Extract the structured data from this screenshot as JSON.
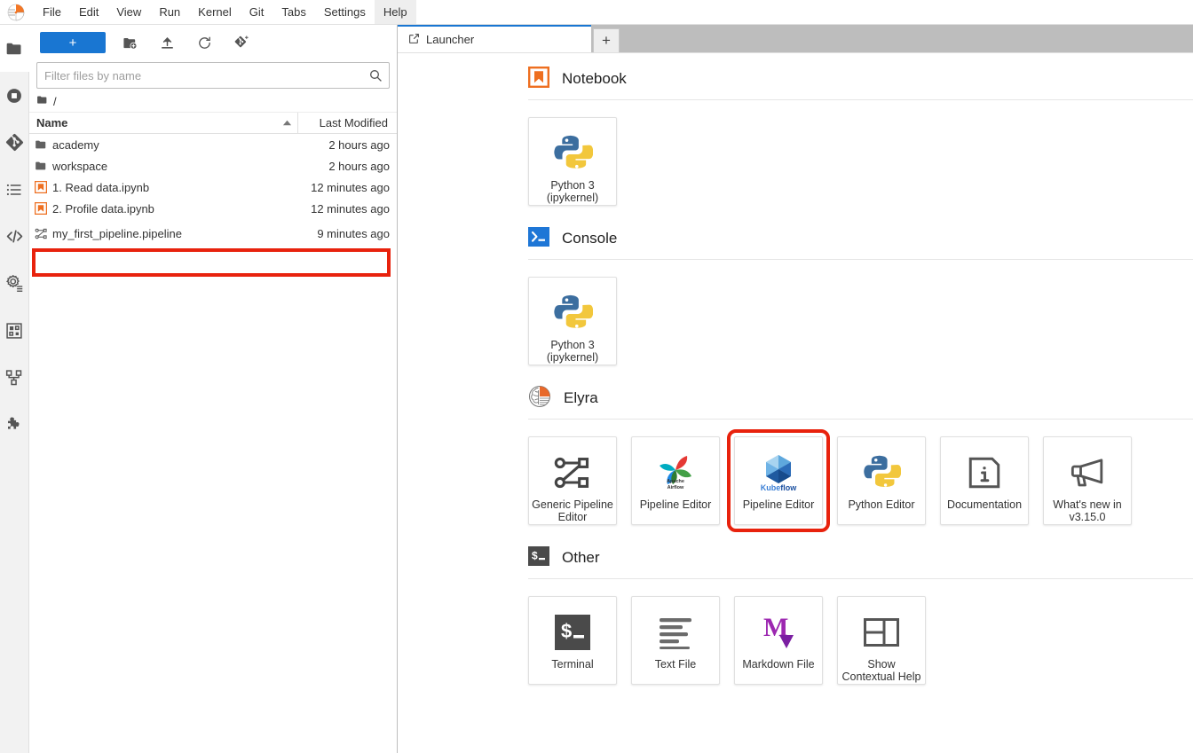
{
  "menubar": {
    "logo_name": "jupyter-logo",
    "items": [
      {
        "label": "File"
      },
      {
        "label": "Edit"
      },
      {
        "label": "View"
      },
      {
        "label": "Run"
      },
      {
        "label": "Kernel"
      },
      {
        "label": "Git"
      },
      {
        "label": "Tabs"
      },
      {
        "label": "Settings"
      },
      {
        "label": "Help",
        "active": true
      }
    ]
  },
  "activitybar": {
    "items": [
      {
        "icon": "folder-icon",
        "name": "sidebar-item-file-browser"
      },
      {
        "icon": "running-terminals-icon",
        "name": "sidebar-item-running"
      },
      {
        "icon": "git-icon",
        "name": "sidebar-item-git"
      },
      {
        "icon": "table-of-contents-icon",
        "name": "sidebar-item-table-of-contents"
      },
      {
        "icon": "code-icon",
        "name": "sidebar-item-debugger"
      },
      {
        "icon": "settings-gear-icon",
        "name": "sidebar-item-pipeline-runtimes"
      },
      {
        "icon": "component-catalog-icon",
        "name": "sidebar-item-component-catalog"
      },
      {
        "icon": "pipeline-nodes-icon",
        "name": "sidebar-item-pipeline-palette"
      },
      {
        "icon": "puzzle-piece-icon",
        "name": "sidebar-item-extension-manager"
      }
    ]
  },
  "filebrowser": {
    "toolbar": {
      "new_label": "+",
      "new_folder_icon": "new-folder-icon",
      "upload_icon": "upload-icon",
      "refresh_icon": "refresh-icon",
      "git_clone_icon": "git-clone-icon"
    },
    "filter": {
      "placeholder": "Filter files by name",
      "value": "",
      "search_icon": "search-icon"
    },
    "breadcrumb": {
      "root_icon": "folder-icon",
      "path": "/"
    },
    "columns": {
      "name": "Name",
      "last_modified": "Last Modified",
      "sort_icon": "sort-ascending-icon"
    },
    "rows": [
      {
        "name": "academy",
        "modified": "2 hours ago",
        "icon": "folder-icon",
        "highlighted": false
      },
      {
        "name": "workspace",
        "modified": "2 hours ago",
        "icon": "folder-icon",
        "highlighted": false
      },
      {
        "name": "1. Read data.ipynb",
        "modified": "12 minutes ago",
        "icon": "notebook-icon",
        "highlighted": false
      },
      {
        "name": "2. Profile data.ipynb",
        "modified": "12 minutes ago",
        "icon": "notebook-icon",
        "highlighted": false
      },
      {
        "name": "my_first_pipeline.pipeline",
        "modified": "9 minutes ago",
        "icon": "pipeline-icon",
        "highlighted": true
      }
    ]
  },
  "main": {
    "tabs": [
      {
        "label": "Launcher",
        "icon": "launcher-icon",
        "active": true
      }
    ],
    "add_tab_label": "+",
    "launcher": {
      "sections": [
        {
          "title": "Notebook",
          "icon": "notebook-icon",
          "cards": [
            {
              "label": "Python 3\n(ipykernel)",
              "icon": "python-icon",
              "highlighted": false
            }
          ]
        },
        {
          "title": "Console",
          "icon": "console-icon",
          "cards": [
            {
              "label": "Python 3\n(ipykernel)",
              "icon": "python-icon",
              "highlighted": false
            }
          ]
        },
        {
          "title": "Elyra",
          "icon": "elyra-icon",
          "cards": [
            {
              "label": "Generic Pipeline Editor",
              "icon": "generic-pipeline-icon",
              "highlighted": false
            },
            {
              "label": "Pipeline Editor",
              "icon": "apache-airflow-icon",
              "highlighted": false
            },
            {
              "label": "Pipeline Editor",
              "icon": "kubeflow-icon",
              "highlighted": true
            },
            {
              "label": "Python Editor",
              "icon": "python-icon",
              "highlighted": false
            },
            {
              "label": "Documentation",
              "icon": "info-icon",
              "highlighted": false
            },
            {
              "label": "What's new in v3.15.0",
              "icon": "megaphone-icon",
              "highlighted": false
            }
          ]
        },
        {
          "title": "Other",
          "icon": "terminal-icon",
          "cards": [
            {
              "label": "Terminal",
              "icon": "terminal-icon",
              "highlighted": false
            },
            {
              "label": "Text File",
              "icon": "text-file-icon",
              "highlighted": false
            },
            {
              "label": "Markdown File",
              "icon": "markdown-icon",
              "highlighted": false
            },
            {
              "label": "Show Contextual Help",
              "icon": "contextual-help-icon",
              "highlighted": false
            }
          ]
        }
      ]
    }
  },
  "colors": {
    "accent_blue": "#1976d2",
    "highlight_red": "#e8220d",
    "notebook_orange": "#ee6f20",
    "elyra_orange": "#e8692a",
    "markdown_purple": "#9c27b0",
    "tabbar_gray": "#bdbdbd"
  }
}
